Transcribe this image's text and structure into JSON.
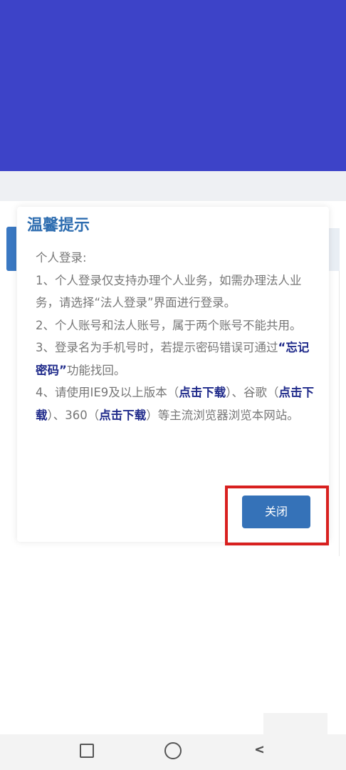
{
  "dialog": {
    "title": "温馨提示",
    "lines": {
      "l0": "个人登录:",
      "l1": "1、个人登录仅支持办理个人业务，如需办理法人业务，请选择“法人登录”界面进行登录。",
      "l2": "2、个人账号和法人账号，属于两个账号不能共用。",
      "l3_a": "3、登录名为手机号时，若提示密码错误可通过",
      "l3_link": "“忘记密码”",
      "l3_b": "功能找回。",
      "l4_a": "4、请使用IE9及以上版本（",
      "l4_link1": "点击下载",
      "l4_b": "）、谷歌（",
      "l4_link2": "点击下载",
      "l4_c": "）、360（",
      "l4_link3": "点击下载",
      "l4_d": "）等主流浏览器浏览本网站。"
    },
    "close_label": "关闭"
  },
  "colors": {
    "header": "#3d43c8",
    "title": "#2e6db0",
    "button": "#3572b8",
    "highlight": "#d8201f"
  },
  "nav": {
    "recent_icon": "square-icon",
    "home_icon": "circle-icon",
    "back_icon": "back-chevron-icon",
    "back_glyph": "<"
  }
}
